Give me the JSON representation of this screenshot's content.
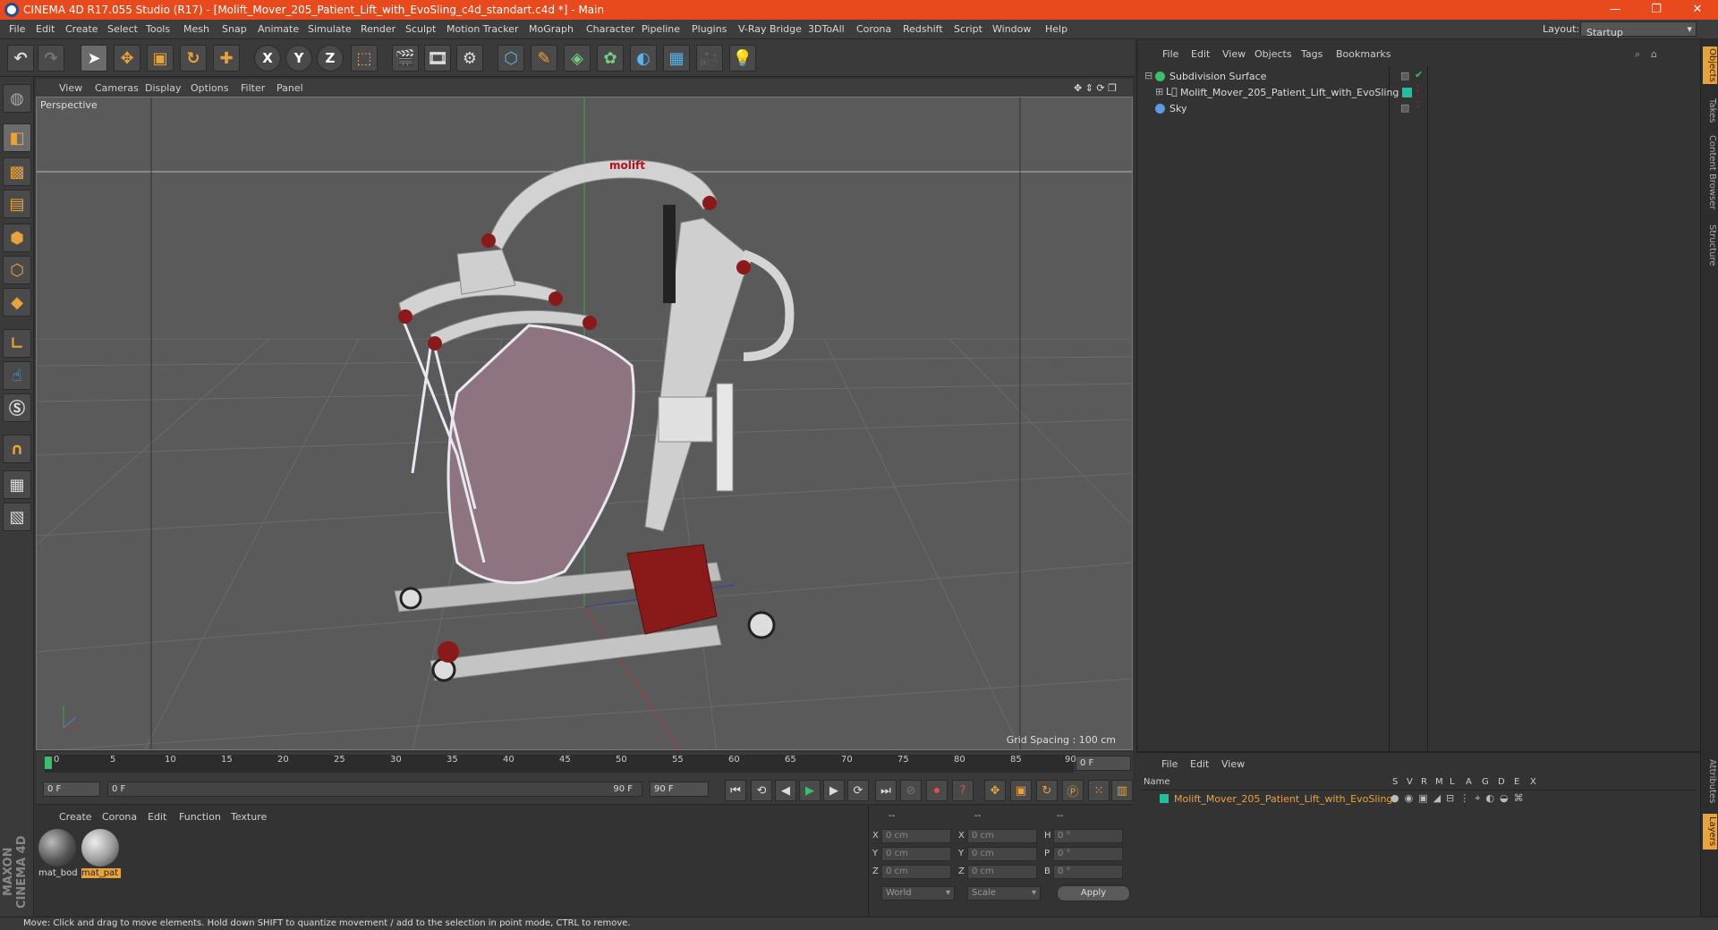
{
  "window": {
    "title": "CINEMA 4D R17.055 Studio (R17) - [Molift_Mover_205_Patient_Lift_with_EvoSling_c4d_standart.c4d *] - Main",
    "minimize": "—",
    "maximize": "❐",
    "close": "✕"
  },
  "menubar": {
    "items": [
      "File",
      "Edit",
      "Create",
      "Select",
      "Tools",
      "Mesh",
      "Snap",
      "Animate",
      "Simulate",
      "Render",
      "Sculpt",
      "Motion Tracker",
      "MoGraph",
      "Character",
      "Pipeline",
      "Plugins",
      "V-Ray Bridge",
      "3DToAll",
      "Corona",
      "Redshift",
      "Script",
      "Window",
      "Help"
    ],
    "layout_label": "Layout:",
    "layout_value": "Startup"
  },
  "viewport": {
    "menu": [
      "View",
      "Cameras",
      "Display",
      "Options",
      "Filter",
      "Panel"
    ],
    "label": "Perspective",
    "grid_spacing": "Grid Spacing : 100 cm",
    "logo_text": "molift",
    "colors": {
      "bg": "#5a5a5a",
      "grid": "#6a6a6a",
      "frame": "#d8d8d8",
      "sling": "#8e7480",
      "red": "#8a1a1a"
    }
  },
  "objects": {
    "menu": [
      "File",
      "Edit",
      "View",
      "Objects",
      "Tags",
      "Bookmarks"
    ],
    "items": [
      {
        "name": "Subdivision Surface"
      },
      {
        "name": "Molift_Mover_205_Patient_Lift_with_EvoSling"
      },
      {
        "name": "Sky"
      }
    ]
  },
  "right_tabs": [
    "Objects",
    "Takes",
    "Content Browser",
    "Structure"
  ],
  "right_tabs_bottom": [
    "Attributes",
    "Layers"
  ],
  "layers": {
    "menu": [
      "File",
      "Edit",
      "View"
    ],
    "header": {
      "name": "Name",
      "cols": [
        "S",
        "V",
        "R",
        "M",
        "L",
        "A",
        "G",
        "D",
        "E",
        "X"
      ]
    },
    "row": "Molift_Mover_205_Patient_Lift_with_EvoSling",
    "row_color": "#e8a33a"
  },
  "timeline": {
    "ticks": [
      "0",
      "5",
      "10",
      "15",
      "20",
      "25",
      "30",
      "35",
      "40",
      "45",
      "50",
      "55",
      "60",
      "65",
      "70",
      "75",
      "80",
      "85",
      "90"
    ],
    "current_frame": "0 F",
    "start_field": "0 F",
    "range_start": "0 F",
    "range_end": "90 F",
    "end_field": "90 F"
  },
  "materials": {
    "menu": [
      "Create",
      "Corona",
      "Edit",
      "Function",
      "Texture"
    ],
    "items": [
      {
        "name": "mat_bod"
      },
      {
        "name": "mat_pat"
      }
    ]
  },
  "coordinates": {
    "headers": [
      "--",
      "--",
      "--"
    ],
    "rows": [
      {
        "a": "X",
        "av": "0 cm",
        "b": "X",
        "bv": "0 cm",
        "c": "H",
        "cv": "0 °"
      },
      {
        "a": "Y",
        "av": "0 cm",
        "b": "Y",
        "bv": "0 cm",
        "c": "P",
        "cv": "0 °"
      },
      {
        "a": "Z",
        "av": "0 cm",
        "b": "Z",
        "bv": "0 cm",
        "c": "B",
        "cv": "0 °"
      }
    ],
    "world": "World",
    "scale": "Scale",
    "apply": "Apply"
  },
  "status": "Move: Click and drag to move elements. Hold down SHIFT to quantize movement / add to the selection in point mode, CTRL to remove.",
  "brand": "MAXON CINEMA 4D"
}
